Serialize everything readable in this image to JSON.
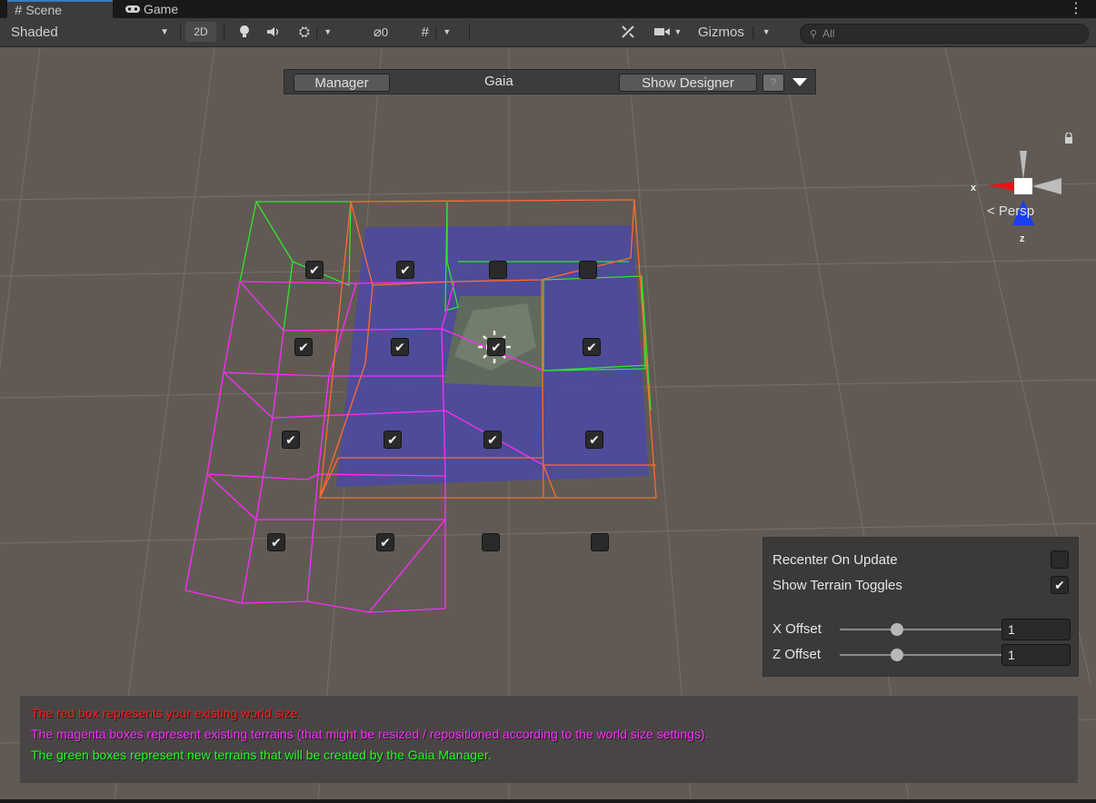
{
  "tabs": [
    {
      "label": "Scene",
      "icon": "grid-hash-icon",
      "active": true
    },
    {
      "label": "Game",
      "icon": "gamepad-icon",
      "active": false
    }
  ],
  "toolbar": {
    "shading_mode": "Shaded",
    "two_d_label": "2D",
    "hidden_count": "0",
    "gizmos_label": "Gizmos",
    "search_placeholder": "All"
  },
  "gaia_bar": {
    "manager_label": "Manager",
    "title": "Gaia",
    "designer_label": "Show Designer",
    "help_label": "?"
  },
  "orientation": {
    "x_axis_label": "x",
    "z_axis_label": "z",
    "projection_label": "< Persp"
  },
  "terrain_toggles": [
    {
      "row": 0,
      "col": 0,
      "checked": true
    },
    {
      "row": 0,
      "col": 1,
      "checked": true
    },
    {
      "row": 0,
      "col": 2,
      "checked": false
    },
    {
      "row": 0,
      "col": 3,
      "checked": false
    },
    {
      "row": 1,
      "col": 0,
      "checked": true
    },
    {
      "row": 1,
      "col": 1,
      "checked": true
    },
    {
      "row": 1,
      "col": 2,
      "checked": true
    },
    {
      "row": 1,
      "col": 3,
      "checked": true
    },
    {
      "row": 2,
      "col": 0,
      "checked": true
    },
    {
      "row": 2,
      "col": 1,
      "checked": true
    },
    {
      "row": 2,
      "col": 2,
      "checked": true
    },
    {
      "row": 2,
      "col": 3,
      "checked": true
    },
    {
      "row": 3,
      "col": 0,
      "checked": true
    },
    {
      "row": 3,
      "col": 1,
      "checked": true
    },
    {
      "row": 3,
      "col": 2,
      "checked": false
    },
    {
      "row": 3,
      "col": 3,
      "checked": false
    }
  ],
  "settings": {
    "recenter_label": "Recenter On Update",
    "recenter_checked": false,
    "show_toggles_label": "Show Terrain Toggles",
    "show_toggles_checked": true,
    "x_offset_label": "X Offset",
    "x_offset_value": "1",
    "z_offset_label": "Z Offset",
    "z_offset_value": "1"
  },
  "info": {
    "red_line": "The red box represents your existing world size.",
    "magenta_line": "The magenta boxes represent existing terrains (that might be resized / repositioned according to the world size settings).",
    "green_line": "The green boxes represent new terrains that will be created by the Gaia Manager.",
    "red_color": "#ff1a1a",
    "magenta_color": "#ff2bff",
    "green_color": "#22ff22"
  }
}
